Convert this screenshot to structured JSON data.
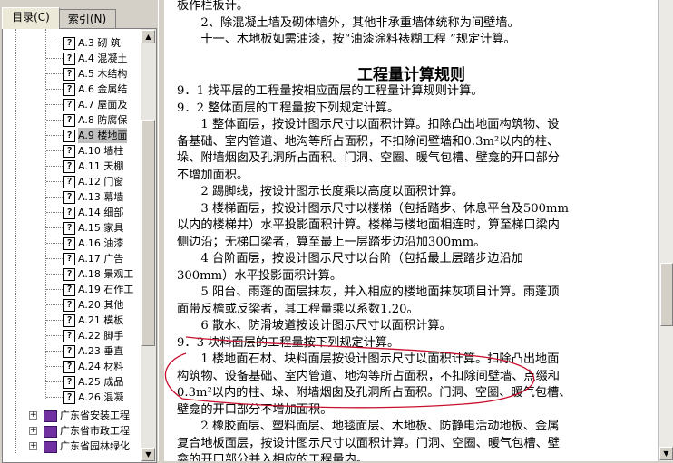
{
  "tabs": [
    {
      "label": "目录(C)"
    },
    {
      "label": "索引(N)"
    }
  ],
  "tree": {
    "items": [
      {
        "label": "A.3  砌  筑"
      },
      {
        "label": "A.4  混凝土"
      },
      {
        "label": "A.5  木结构"
      },
      {
        "label": "A.6  金属结"
      },
      {
        "label": "A.7  屋面及"
      },
      {
        "label": "A.8  防腐保"
      },
      {
        "label": "A.9  楼地面"
      },
      {
        "label": "A.10  墙柱"
      },
      {
        "label": "A.11  天棚"
      },
      {
        "label": "A.12  门窗"
      },
      {
        "label": "A.13  幕墙"
      },
      {
        "label": "A.14  细部"
      },
      {
        "label": "A.15  家具"
      },
      {
        "label": "A.16  油漆"
      },
      {
        "label": "A.17  广告"
      },
      {
        "label": "A.18  景观工"
      },
      {
        "label": "A.19  石作工"
      },
      {
        "label": "A.20  其他"
      },
      {
        "label": "A.21  模板"
      },
      {
        "label": "A.22  脚手"
      },
      {
        "label": "A.23  垂直"
      },
      {
        "label": "A.24  材料"
      },
      {
        "label": "A.25  成品"
      },
      {
        "label": "A.26  混凝"
      }
    ],
    "books": [
      {
        "label": "广东省安装工程"
      },
      {
        "label": "广东省市政工程"
      },
      {
        "label": "广东省园林绿化"
      }
    ],
    "selected_index": 6
  },
  "doc": {
    "lines": [
      "板作栏板计。",
      "　　2、除混凝土墙及砌体墙外，其他非承重墙体统称为间壁墙。",
      "　　十一、木地板如需油漆，按“油漆涂料裱糊工程 ”规定计算。"
    ],
    "heading": "工程量计算规则",
    "rules": [
      "9．1  找平层的工程量按相应面层的工程量计算规则计算。",
      "9．2  整体面层的工程量按下列规定计算。",
      "　　1  整体面层，按设计图示尺寸以面积计算。扣除凸出地面构筑物、设",
      "备基础、室内管道、地沟等所占面积，不扣除间壁墙和0.3m²以内的柱、",
      "垛、附墙烟囱及孔洞所占面积。门洞、空圈、暖气包槽、壁龛的开口部分",
      "不增加面积。",
      "　　2  踢脚线，按设计图示长度乘以高度以面积计算。",
      "　　3  楼梯面层，按设计图示尺寸以楼梯（包括踏步、休息平台及500mm",
      "以内的楼梯井）水平投影面积计算。楼梯与楼地面相连时，算至梯口梁内",
      "侧边沿；无梯口梁者，算至最上一层踏步边沿加300mm。",
      "　　4  台阶面层，按设计图示尺寸以台阶（包括最上层踏步边沿加",
      "300mm）水平投影面积计算。",
      "　　5  阳台、雨蓬的面层抹灰，并入相应的楼地面抹灰项目计算。雨蓬顶",
      "面带反檐或反梁者，其工程量乘以系数1.20。",
      "　　6  散水、防滑坡道按设计图示尺寸以面积计算。",
      "9．3  块料面层的工程量按下列规定计算。",
      "　　1  楼地面石材、块料面层按设计图示尺寸以面积计算。扣除凸出地面",
      "构筑物、设备基础、室内管道、地沟等所占面积，不扣除间壁墙、点缀和",
      "0.3m²以内的柱、垛、附墙烟囱及孔洞所占面积。门洞、空圈、暖气包槽、",
      "壁龛的开口部分不增加面积。",
      "　　2  橡胶面层、塑料面层、地毯面层、木地板、防静电活动地板、金属",
      "复合地板面层，按设计图示尺寸以面积计算。门洞、空圈、暖气包槽、壁",
      "龛的开口部分并入相应的工程量内。"
    ]
  },
  "colors": {
    "annotation": "#c8102e",
    "book": "#7030a0",
    "selection": "#c0c0c0"
  }
}
